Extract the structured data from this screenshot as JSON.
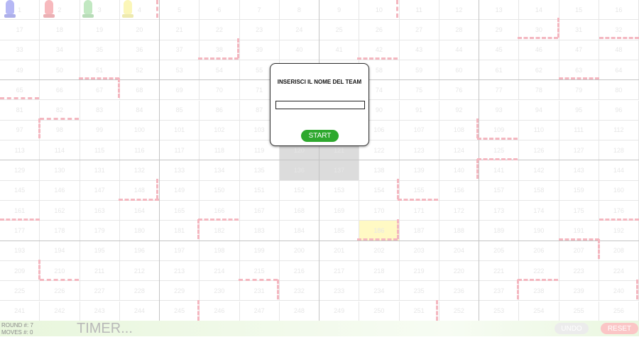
{
  "board": {
    "cols": 16,
    "rows": 16,
    "cell_number_start": 1
  },
  "robots": [
    {
      "name": "blue-robot",
      "color": "#b6b8f5"
    },
    {
      "name": "red-robot",
      "color": "#f7b9bd"
    },
    {
      "name": "green-robot",
      "color": "#c2e8c2"
    },
    {
      "name": "yellow-robot",
      "color": "#fbf6b8"
    }
  ],
  "target": {
    "col": 9,
    "row": 11,
    "color": "#fff9c4"
  },
  "center_block_color": "#dcdcdc",
  "modal": {
    "title": "INSERISCI IL NOME DEL TEAM",
    "input_value": "",
    "start_label": "START"
  },
  "status": {
    "round_label": "ROUND #:",
    "round_value": "7",
    "moves_label": "MOVES #:",
    "moves_value": "0",
    "timer": "TIMER..."
  },
  "buttons": {
    "undo": "UNDO",
    "reset": "RESET"
  },
  "colors": {
    "wall": "#f4b6bf",
    "start_button": "#2ea82e",
    "reset_button": "#fbc6c6",
    "undo_button": "#ececec"
  }
}
